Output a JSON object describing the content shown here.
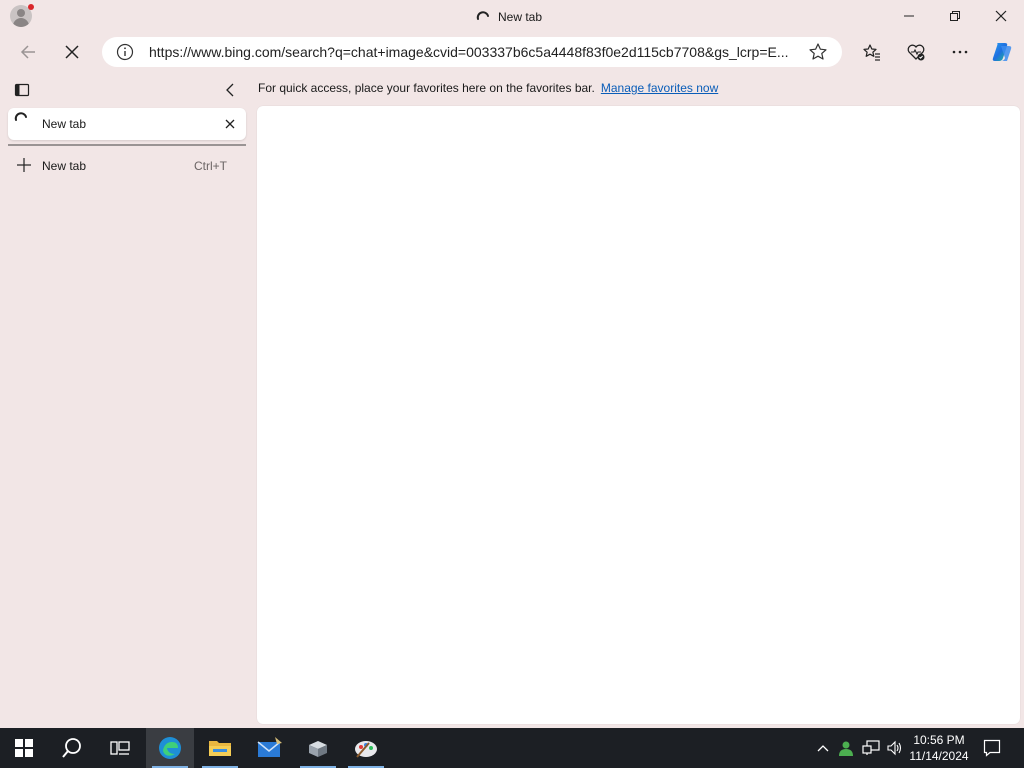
{
  "window": {
    "title": "New tab",
    "minimize_icon": "minimize-icon",
    "restore_icon": "restore-icon",
    "close_icon": "close-icon"
  },
  "toolbar": {
    "back_icon": "back-arrow-icon",
    "stop_icon": "stop-loading-icon",
    "url": "https://www.bing.com/search?q=chat+image&cvid=003337b6c5a4448f83f0e2d115cb7708&gs_lcrp=E...",
    "info_icon": "site-info-icon",
    "favorite_icon": "add-favorite-star-icon",
    "favorites_icon": "favorites-icon",
    "browser_essentials_icon": "browser-essentials-icon",
    "more_icon": "more-options-icon",
    "copilot_icon": "copilot-icon"
  },
  "favorites_bar": {
    "message": "For quick access, place your favorites here on the favorites bar.",
    "link": "Manage favorites now"
  },
  "vertical_tabs": {
    "tabs": [
      {
        "label": "New tab",
        "loading": true
      }
    ],
    "new_tab_label": "New tab",
    "new_tab_shortcut": "Ctrl+T"
  },
  "taskbar": {
    "items": [
      "start-icon",
      "search-icon",
      "task-view-icon",
      "edge-icon",
      "file-explorer-icon",
      "mail-icon",
      "app-icon",
      "paint-icon"
    ],
    "clock_time": "10:56 PM",
    "clock_date": "11/14/2024"
  },
  "colors": {
    "frame": "#f2e6e6",
    "link": "#0a5db8",
    "taskbar": "#1c1f24"
  }
}
